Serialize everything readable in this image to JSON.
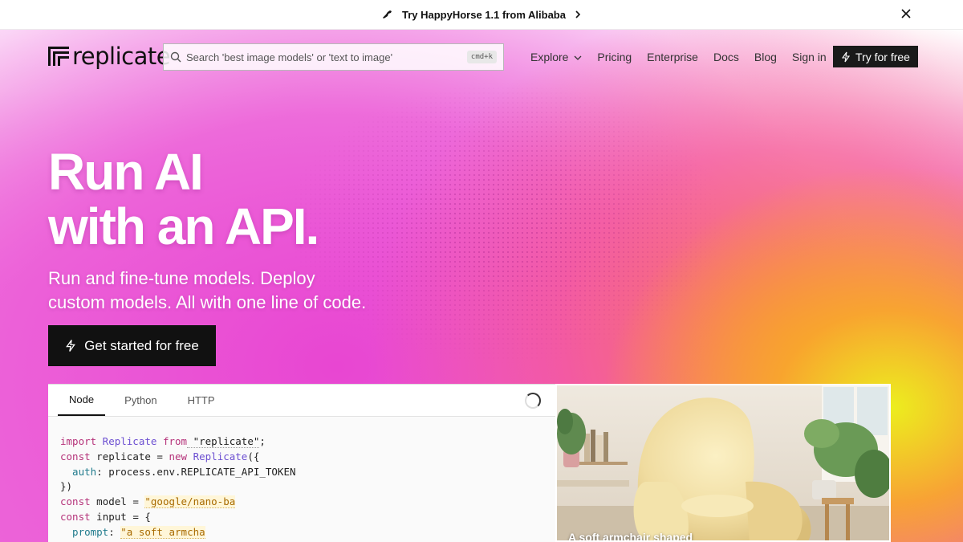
{
  "announcement": {
    "text": "Try HappyHorse 1.1 from Alibaba"
  },
  "nav": {
    "logo_text": "replicate",
    "search_placeholder": "Search 'best image models' or 'text to image'",
    "search_shortcut": "cmd+k",
    "links": [
      "Explore",
      "Pricing",
      "Enterprise",
      "Docs",
      "Blog",
      "Sign in"
    ],
    "cta_label": "Try for free"
  },
  "hero": {
    "title_line1": "Run AI",
    "title_line2": "with an API.",
    "subtitle_line1": "Run and fine-tune models. Deploy",
    "subtitle_line2": "custom models. All with one line of code.",
    "cta_label": "Get started for free"
  },
  "code_panel": {
    "tabs": [
      "Node",
      "Python",
      "HTTP"
    ],
    "active_tab": "Node",
    "lines": [
      {
        "t1": "import",
        "t2": " Replicate ",
        "t3": "from",
        "t4": " \"replicate\"",
        "t5": ";"
      },
      {
        "t1": "const",
        "t2": " replicate = ",
        "t3": "new",
        "t4": " Replicate",
        "t5": "({"
      },
      {
        "t1": "  auth",
        "t2": ": process.env.REPLICATE_API_TOKEN"
      },
      {
        "t1": "})"
      },
      {
        "t1": "const",
        "t2": " model = ",
        "t3": "\"google/nano-ba"
      },
      {
        "t1": "const",
        "t2": " input = {"
      },
      {
        "t1": "  prompt",
        "t2": ": ",
        "t3": "\"a soft armcha"
      }
    ]
  },
  "image_panel": {
    "caption": "A soft armchair shaped"
  },
  "colors": {
    "accent_dark": "#111111",
    "gradient_pink": "#e94ecf",
    "gradient_yellow": "#ecee1e"
  }
}
